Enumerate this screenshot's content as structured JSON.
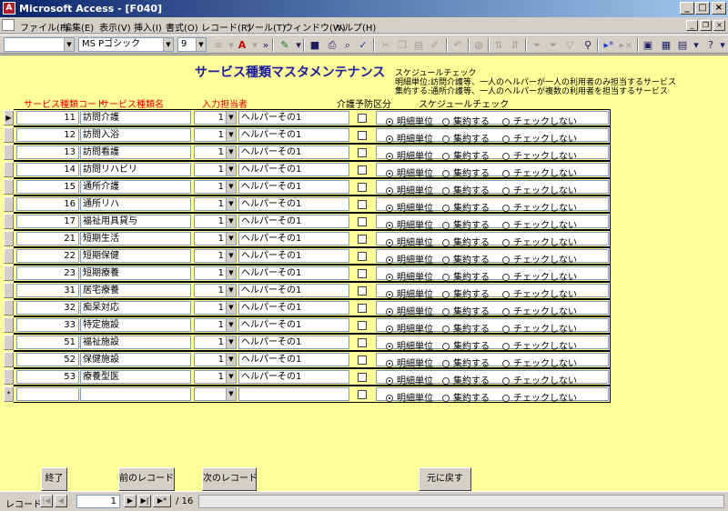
{
  "window": {
    "title": "Microsoft Access - [F040]",
    "app_icon": "access-icon"
  },
  "menu": [
    "ファイル(F)",
    "編集(E)",
    "表示(V)",
    "挿入(I)",
    "書式(O)",
    "レコード(R)",
    "ツール(T)",
    "ウィンドウ(W)",
    "ヘルプ(H)"
  ],
  "toolbar": {
    "object_combo": "",
    "font_combo": "MS Pゴシック",
    "size_combo": "9"
  },
  "form": {
    "heading": "サービス種類マスタメンテナンス",
    "schedule_title": "スケジュールチェック",
    "note_line1": "明細単位:訪問介護等、一人のヘルパーが一人の利用者のみ担当するサービス",
    "note_line2": "集約する:通所介護等、一人のヘルパーが複数の利用者を担当するサービス",
    "headers": {
      "service_code": "サービス種類コード",
      "service_name": "サービス種類名",
      "staff": "入力担当者",
      "prevention": "介護予防区分",
      "schedule_check": "スケジュールチェック"
    },
    "radio_labels": [
      "明細単位",
      "集約する",
      "チェックしない"
    ],
    "rows": [
      {
        "selector": "▶",
        "code": "11",
        "name": "訪問介護",
        "staff_no": "1",
        "staff_name": "ヘルパーその1"
      },
      {
        "selector": "",
        "code": "12",
        "name": "訪問入浴",
        "staff_no": "1",
        "staff_name": "ヘルパーその1"
      },
      {
        "selector": "",
        "code": "13",
        "name": "訪問看護",
        "staff_no": "1",
        "staff_name": "ヘルパーその1"
      },
      {
        "selector": "",
        "code": "14",
        "name": "訪問リハビリ",
        "staff_no": "1",
        "staff_name": "ヘルパーその1"
      },
      {
        "selector": "",
        "code": "15",
        "name": "通所介護",
        "staff_no": "1",
        "staff_name": "ヘルパーその1"
      },
      {
        "selector": "",
        "code": "16",
        "name": "通所リハ",
        "staff_no": "1",
        "staff_name": "ヘルパーその1"
      },
      {
        "selector": "",
        "code": "17",
        "name": "福祉用具貸与",
        "staff_no": "1",
        "staff_name": "ヘルパーその1"
      },
      {
        "selector": "",
        "code": "21",
        "name": "短期生活",
        "staff_no": "1",
        "staff_name": "ヘルパーその1"
      },
      {
        "selector": "",
        "code": "22",
        "name": "短期保健",
        "staff_no": "1",
        "staff_name": "ヘルパーその1"
      },
      {
        "selector": "",
        "code": "23",
        "name": "短期療養",
        "staff_no": "1",
        "staff_name": "ヘルパーその1"
      },
      {
        "selector": "",
        "code": "31",
        "name": "居宅療養",
        "staff_no": "1",
        "staff_name": "ヘルパーその1"
      },
      {
        "selector": "",
        "code": "32",
        "name": "痴呆対応",
        "staff_no": "1",
        "staff_name": "ヘルパーその1"
      },
      {
        "selector": "",
        "code": "33",
        "name": "特定施設",
        "staff_no": "1",
        "staff_name": "ヘルパーその1"
      },
      {
        "selector": "",
        "code": "51",
        "name": "福祉施設",
        "staff_no": "1",
        "staff_name": "ヘルパーその1"
      },
      {
        "selector": "",
        "code": "52",
        "name": "保健施設",
        "staff_no": "1",
        "staff_name": "ヘルパーその1"
      },
      {
        "selector": "",
        "code": "53",
        "name": "療養型医",
        "staff_no": "1",
        "staff_name": "ヘルパーその1"
      },
      {
        "selector": "*",
        "code": "",
        "name": "",
        "staff_no": "",
        "staff_name": ""
      }
    ]
  },
  "buttons": {
    "close": "終了",
    "prev": "前のレコード",
    "next": "次のレコード",
    "undo": "元に戻す"
  },
  "navigation": {
    "label": "レコード:",
    "current": "1",
    "total": "/ 16"
  },
  "colors": {
    "form_background": "#ffff99",
    "heading": "#1a1aa0",
    "header_red": "#e00000",
    "titlebar": "#0a246a"
  }
}
